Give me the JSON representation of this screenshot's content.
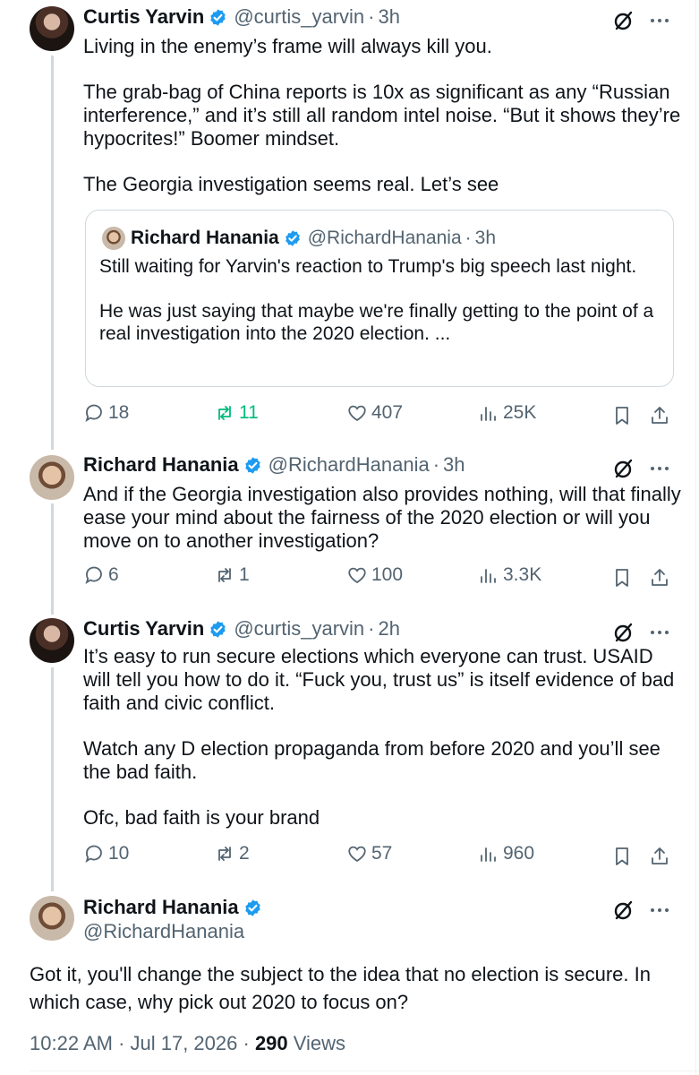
{
  "tweets": [
    {
      "name": "Curtis Yarvin",
      "handle": "@curtis_yarvin",
      "time": "3h",
      "paragraphs": [
        "Living in the enemy’s frame will always kill you.",
        "The grab-bag of China reports is 10x as significant as any “Russian interference,” and it’s still all random intel noise. “But it shows they’re hypocrites!” Boomer mindset.",
        "The Georgia investigation seems real. Let’s see"
      ],
      "quote": {
        "name": "Richard Hanania",
        "handle": "@RichardHanania",
        "time": "3h",
        "paragraphs": [
          "Still waiting for Yarvin's reaction to Trump's big speech last night.",
          "He was just saying that maybe we're finally getting to the point of a real investigation into the 2020 election. ..."
        ]
      },
      "replies": "18",
      "reposts": "11",
      "likes": "407",
      "views": "25K"
    },
    {
      "name": "Richard Hanania",
      "handle": "@RichardHanania",
      "time": "3h",
      "paragraphs": [
        "And if the Georgia investigation also provides nothing, will that finally ease your mind about the fairness of the 2020 election or will you move on to another investigation?"
      ],
      "replies": "6",
      "reposts": "1",
      "likes": "100",
      "views": "3.3K"
    },
    {
      "name": "Curtis Yarvin",
      "handle": "@curtis_yarvin",
      "time": "2h",
      "paragraphs": [
        "It’s easy to run secure elections which everyone can trust. USAID will tell you how to do it. “Fuck you, trust us” is itself evidence of bad faith and civic conflict.",
        "Watch any D election propaganda from before 2020 and you’ll see the bad faith.",
        "Ofc, bad faith is your brand"
      ],
      "replies": "10",
      "reposts": "2",
      "likes": "57",
      "views": "960"
    }
  ],
  "main_tweet": {
    "name": "Richard Hanania",
    "handle": "@RichardHanania",
    "text": "Got it, you'll change the subject to the idea that no election is secure. In which case, why pick out 2020 to focus on?",
    "timestamp": "10:22 AM · Jul 17, 2026 · ",
    "views_count": "290",
    "views_label": " Views"
  },
  "icons": {
    "verified": "verified-badge-icon",
    "grok": "grok-icon",
    "more": "more-icon",
    "reply": "reply-icon",
    "repost": "repost-icon",
    "like": "heart-icon",
    "views": "views-bar-chart-icon",
    "bookmark": "bookmark-icon",
    "share": "share-icon"
  },
  "colors": {
    "text": "#0f1419",
    "secondary": "#536471",
    "verified": "#1d9bf0",
    "repost_active": "#00ba7c",
    "border": "#cfd9de"
  }
}
